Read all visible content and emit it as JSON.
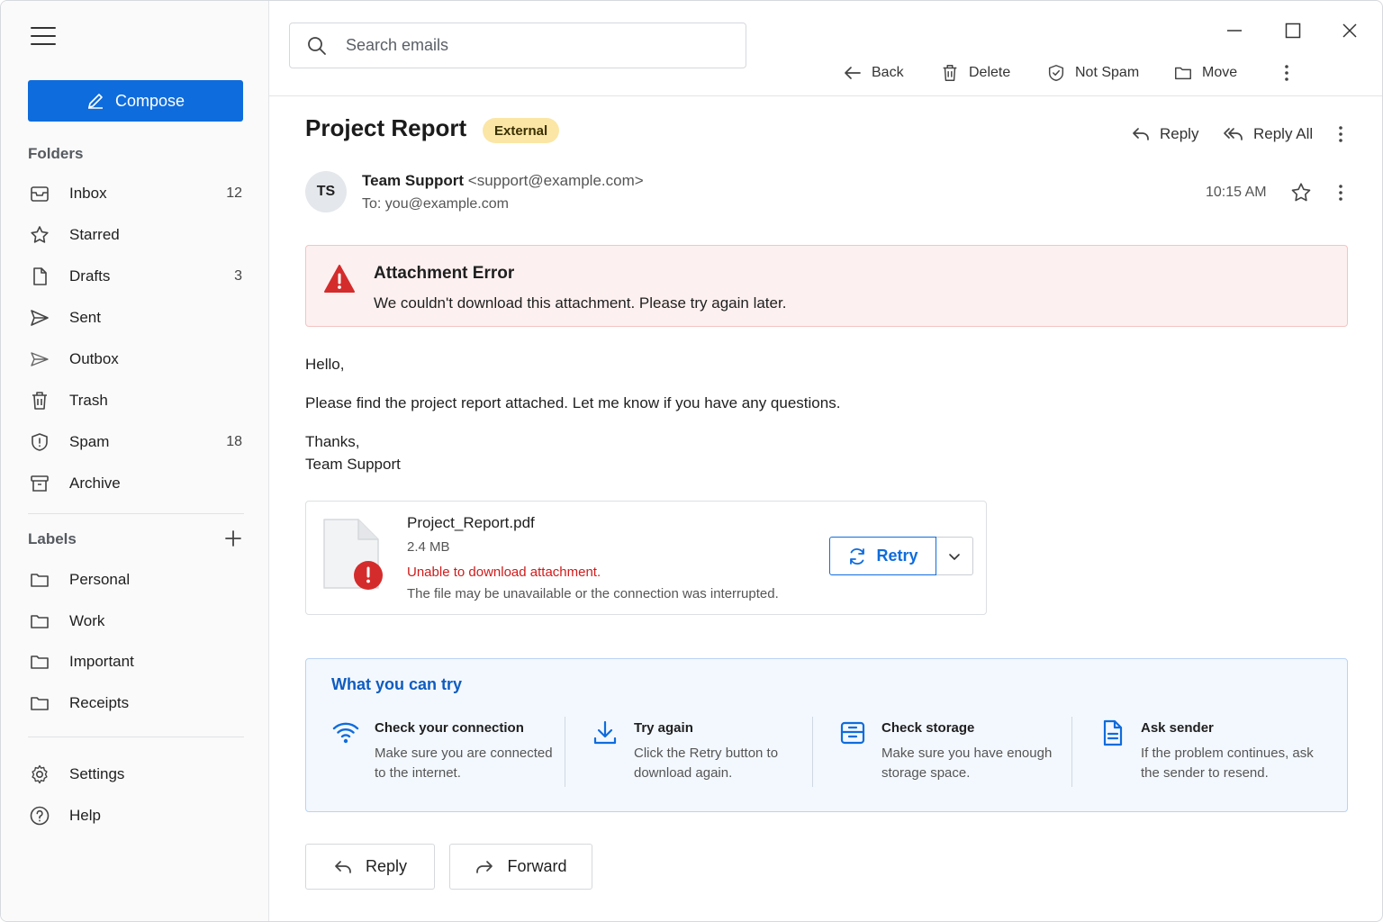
{
  "sidebar": {
    "compose_label": "Compose",
    "folders_heading": "Folders",
    "folders": [
      {
        "label": "Inbox",
        "count": "12",
        "icon": "inbox-icon"
      },
      {
        "label": "Starred",
        "count": "",
        "icon": "star-icon"
      },
      {
        "label": "Drafts",
        "count": "3",
        "icon": "draft-icon"
      },
      {
        "label": "Sent",
        "count": "",
        "icon": "send-icon"
      },
      {
        "label": "Outbox",
        "count": "",
        "icon": "outbox-icon"
      },
      {
        "label": "Trash",
        "count": "",
        "icon": "trash-icon"
      },
      {
        "label": "Spam",
        "count": "18",
        "icon": "shield-icon"
      },
      {
        "label": "Archive",
        "count": "",
        "icon": "archive-icon"
      }
    ],
    "labels_heading": "Labels",
    "labels": [
      {
        "label": "Personal",
        "icon": "folder-icon"
      },
      {
        "label": "Work",
        "icon": "folder-icon"
      },
      {
        "label": "Important",
        "icon": "folder-icon"
      },
      {
        "label": "Receipts",
        "icon": "folder-icon"
      }
    ],
    "settings_label": "Settings",
    "help_label": "Help"
  },
  "search": {
    "placeholder": "Search emails"
  },
  "toolbar": {
    "back_label": "Back",
    "delete_label": "Delete",
    "not_spam_label": "Not Spam",
    "move_label": "Move"
  },
  "email": {
    "subject": "Project Report",
    "badge": "External",
    "reply_label": "Reply",
    "reply_all_label": "Reply All",
    "avatar_initials": "TS",
    "sender_name": "Team Support",
    "sender_email": "<support@example.com>",
    "to_line": "To: you@example.com",
    "time": "10:15 AM",
    "body": {
      "greeting": "Hello,",
      "paragraph": "Please find the project report attached. Let me know if you have any questions.",
      "closing": "Thanks,",
      "signature": "Team Support"
    }
  },
  "error_banner": {
    "title": "Attachment Error",
    "message": "We couldn't download this attachment. Please try again later."
  },
  "attachment": {
    "filename": "Project_Report.pdf",
    "size": "2.4 MB",
    "error": "Unable to download attachment.",
    "detail": "The file may be unavailable or the connection was interrupted.",
    "retry_label": "Retry"
  },
  "tips": {
    "title": "What you can try",
    "items": [
      {
        "heading": "Check your connection",
        "description": "Make sure you are connected to the internet.",
        "icon": "wifi-icon"
      },
      {
        "heading": "Try again",
        "description": "Click the Retry button to download again.",
        "icon": "download-icon"
      },
      {
        "heading": "Check storage",
        "description": "Make sure you have enough storage space.",
        "icon": "storage-icon"
      },
      {
        "heading": "Ask sender",
        "description": "If the problem continues, ask the sender to resend.",
        "icon": "document-icon"
      }
    ]
  },
  "actions": {
    "reply_label": "Reply",
    "forward_label": "Forward"
  },
  "colors": {
    "accent": "#0f6cdc",
    "error": "#d11a1a",
    "badge_bg": "#fbe6a6",
    "error_bg": "#fdf0f0",
    "tips_bg": "#f3f8fe"
  }
}
